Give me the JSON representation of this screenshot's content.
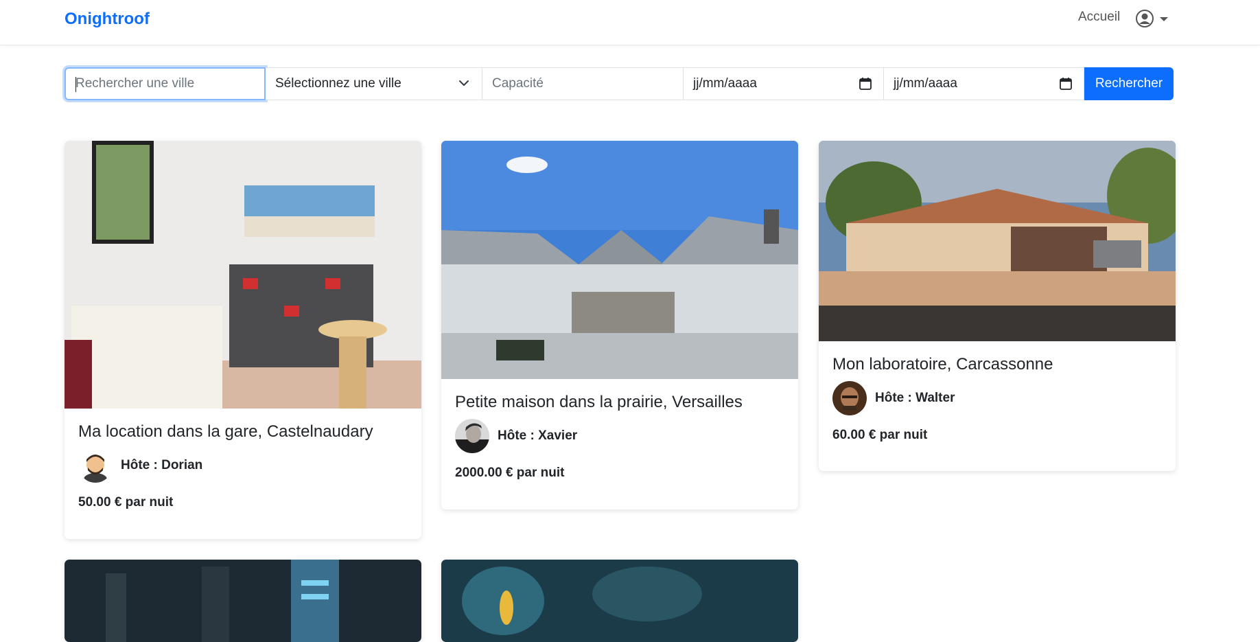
{
  "navbar": {
    "brand": "Onightroof",
    "home_link": "Accueil",
    "user_icon": "user-circle-icon"
  },
  "search": {
    "city_placeholder": "Rechercher une ville",
    "city_select_value": "Sélectionnez une ville",
    "capacity_placeholder": "Capacité",
    "date_start_placeholder": "jj/mm/aaaa",
    "date_end_placeholder": "jj/mm/aaaa",
    "submit_label": "Rechercher"
  },
  "listings": [
    {
      "title": "Ma location dans la gare, Castelnaudary",
      "host": "Hôte : Dorian",
      "price": "50.00 € par nuit"
    },
    {
      "title": "Petite maison dans la prairie, Versailles",
      "host": "Hôte : Xavier",
      "price": "2000.00 € par nuit"
    },
    {
      "title": "Mon laboratoire, Carcassonne",
      "host": "Hôte : Walter",
      "price": "60.00 € par nuit"
    }
  ],
  "colors": {
    "primary": "#0d6efd",
    "text": "#212529",
    "muted": "#6c757d"
  }
}
